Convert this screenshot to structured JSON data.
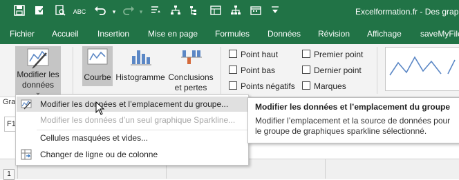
{
  "window": {
    "title": "Excelformation.fr  -  Des grap"
  },
  "quick_access": {
    "icons": [
      "save-icon",
      "sync-icon",
      "print-preview-icon",
      "spelling-icon",
      "undo-icon",
      "redo-icon",
      "sort-icon",
      "tree-icon",
      "outline-icon",
      "table-icon",
      "hierarchy-icon",
      "calendar-icon"
    ],
    "spelling_label": "ABC"
  },
  "menubar": {
    "tabs": [
      "Fichier",
      "Accueil",
      "Insertion",
      "Mise en page",
      "Formules",
      "Données",
      "Révision",
      "Affichage",
      "saveMyFile"
    ]
  },
  "ribbon": {
    "edit_data": {
      "line1": "Modifier les",
      "line2": "données",
      "arrow": "⌄"
    },
    "line_button": "Courbe",
    "column_button": "Histogramme",
    "winloss_line1": "Conclusions",
    "winloss_line2": "et pertes",
    "checkboxes": {
      "high_point": "Point haut",
      "low_point": "Point bas",
      "negative_points": "Points négatifs",
      "first_point": "Premier point",
      "last_point": "Dernier point",
      "markers": "Marques"
    },
    "group_stub": "Gra"
  },
  "formula_bar": {
    "name_box": "F1"
  },
  "grid": {
    "row_number": "1"
  },
  "dropdown": {
    "items": [
      {
        "label": "Modifier les données et l’emplacement du groupe...",
        "highlighted": true,
        "enabled": true
      },
      {
        "label": "Modifier les données d’un seul graphique Sparkline...",
        "highlighted": false,
        "enabled": false
      },
      {
        "label": "Cellules masquées et vides...",
        "highlighted": false,
        "enabled": true
      },
      {
        "label": "Changer de ligne ou de colonne",
        "highlighted": false,
        "enabled": true
      }
    ]
  },
  "tooltip": {
    "title": "Modifier les données et l’emplacement du groupe",
    "body": "Modifier l’emplacement et la source de données pour le groupe de graphiques sparkline sélectionné."
  },
  "colors": {
    "excel_green": "#217346",
    "ribbon_bg": "#f3f3f3",
    "pressed_button": "#c5c5c5",
    "highlight": "#e0e0e0",
    "sparkline_blue": "#5b87c5"
  }
}
